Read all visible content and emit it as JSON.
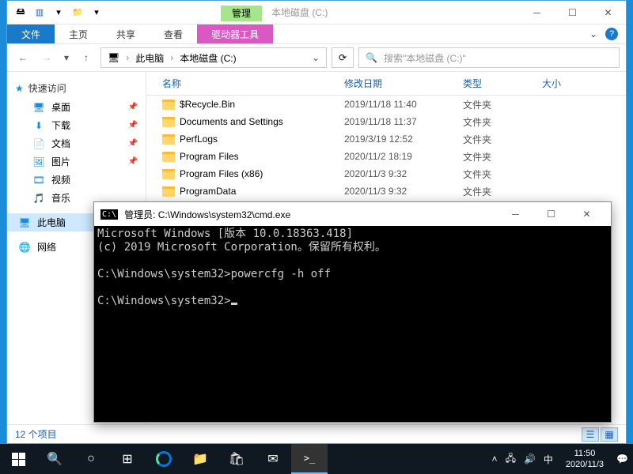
{
  "explorer": {
    "manage_chip": "管理",
    "title": "本地磁盘 (C:)",
    "tabs": {
      "file": "文件",
      "home": "主页",
      "share": "共享",
      "view": "查看",
      "drive": "驱动器工具"
    },
    "breadcrumb": {
      "pc": "此电脑",
      "drive": "本地磁盘 (C:)"
    },
    "search_placeholder": "搜索\"本地磁盘 (C:)\"",
    "sidebar": {
      "quick": "快速访问",
      "items": [
        "桌面",
        "下载",
        "文档",
        "图片",
        "视频",
        "音乐"
      ],
      "thispc": "此电脑",
      "network": "网络"
    },
    "columns": {
      "name": "名称",
      "date": "修改日期",
      "type": "类型",
      "size": "大小"
    },
    "rows": [
      {
        "name": "$Recycle.Bin",
        "date": "2019/11/18 11:40",
        "type": "文件夹"
      },
      {
        "name": "Documents and Settings",
        "date": "2019/11/18 11:37",
        "type": "文件夹"
      },
      {
        "name": "PerfLogs",
        "date": "2019/3/19 12:52",
        "type": "文件夹"
      },
      {
        "name": "Program Files",
        "date": "2020/11/2 18:19",
        "type": "文件夹"
      },
      {
        "name": "Program Files (x86)",
        "date": "2020/11/3 9:32",
        "type": "文件夹"
      },
      {
        "name": "ProgramData",
        "date": "2020/11/3 9:32",
        "type": "文件夹"
      }
    ],
    "status": "12 个项目"
  },
  "cmd": {
    "title": "管理员: C:\\Windows\\system32\\cmd.exe",
    "line1": "Microsoft Windows [版本 10.0.18363.418]",
    "line2": "(c) 2019 Microsoft Corporation。保留所有权利。",
    "line3": "C:\\Windows\\system32>powercfg -h off",
    "line4": "C:\\Windows\\system32>"
  },
  "taskbar": {
    "ime": "中",
    "time": "11:50",
    "date": "2020/11/3"
  }
}
